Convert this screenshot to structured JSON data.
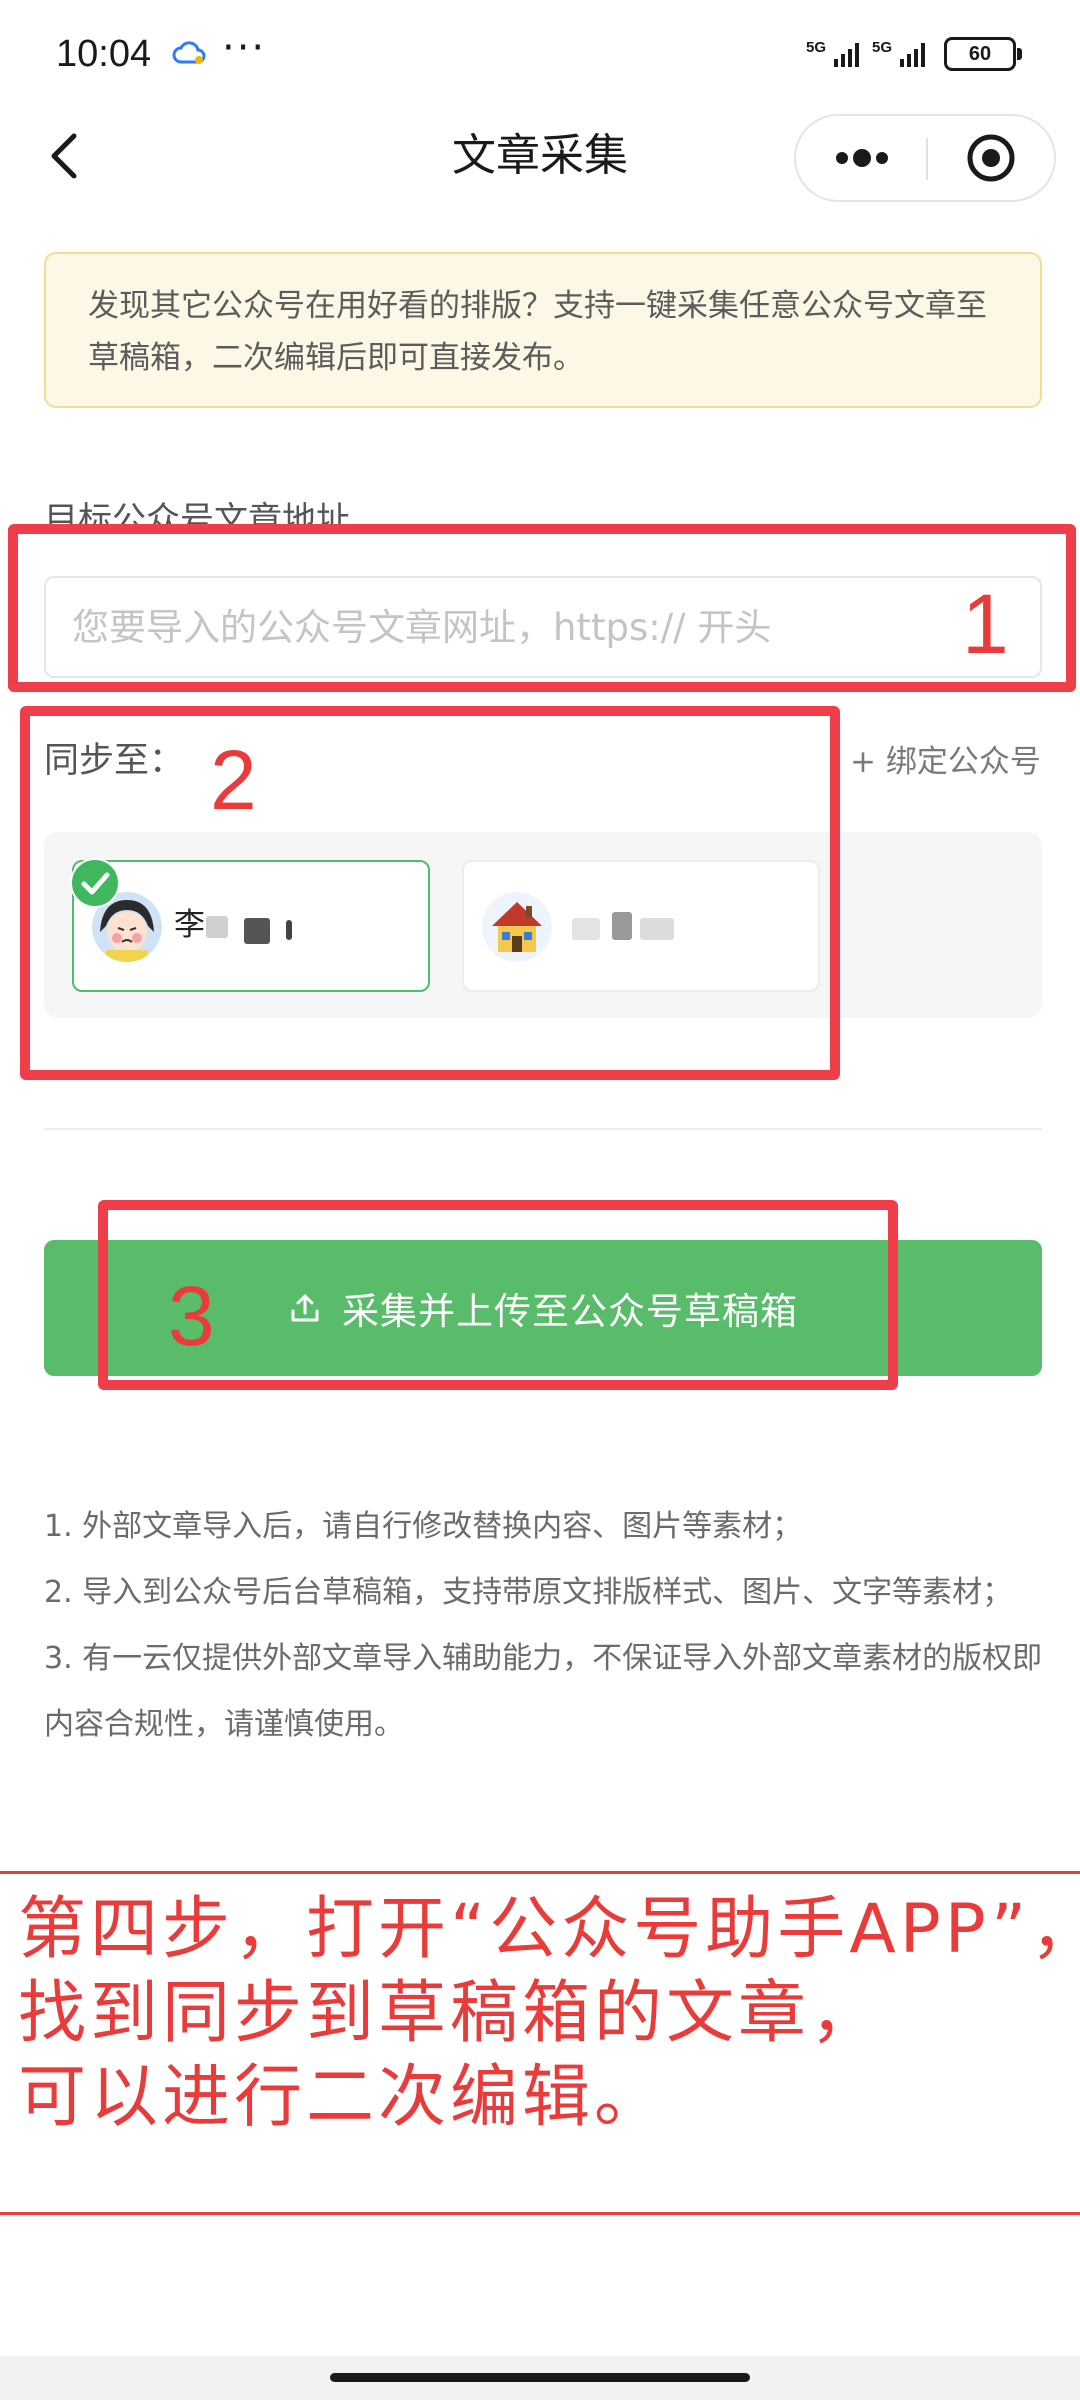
{
  "status_bar": {
    "time": "10:04",
    "more": "···",
    "signal_1": "5G",
    "signal_2": "5G",
    "battery": "60"
  },
  "nav": {
    "title": "文章采集"
  },
  "notice": {
    "text": "发现其它公众号在用好看的排版？支持一键采集任意公众号文章至草稿箱，二次编辑后即可直接发布。"
  },
  "form": {
    "url_label": "目标公众号文章地址",
    "url_placeholder": "您要导入的公众号文章网址，https:// 开头",
    "url_value": "",
    "sync_label": "同步至：",
    "bind_link": "+ 绑定公众号",
    "accounts": [
      {
        "name": "李",
        "selected": true
      },
      {
        "name": "",
        "selected": false
      }
    ]
  },
  "action": {
    "label": "采集并上传至公众号草稿箱"
  },
  "notes": [
    "1. 外部文章导入后，请自行修改替换内容、图片等素材；",
    "2. 导入到公众号后台草稿箱，支持带原文排版样式、图片、文字等素材；",
    "3. 有一云仅提供外部文章导入辅助能力，不保证导入外部文章素材的版权即内容合规性，请谨慎使用。"
  ],
  "annotation": {
    "line_1": "第四步，打开“公众号助手APP”，",
    "line_2": "找到同步到草稿箱的文章，",
    "line_3": "可以进行二次编辑。",
    "steps": [
      "1",
      "2",
      "3"
    ]
  },
  "colors": {
    "accent_green": "#58bc6b",
    "annotation_red": "#ea3b3b"
  },
  "icons": {
    "back": "chevron-left-icon",
    "more": "more-dots-icon",
    "close": "target-circle-icon",
    "upload": "upload-icon",
    "check": "check-circle-icon"
  }
}
